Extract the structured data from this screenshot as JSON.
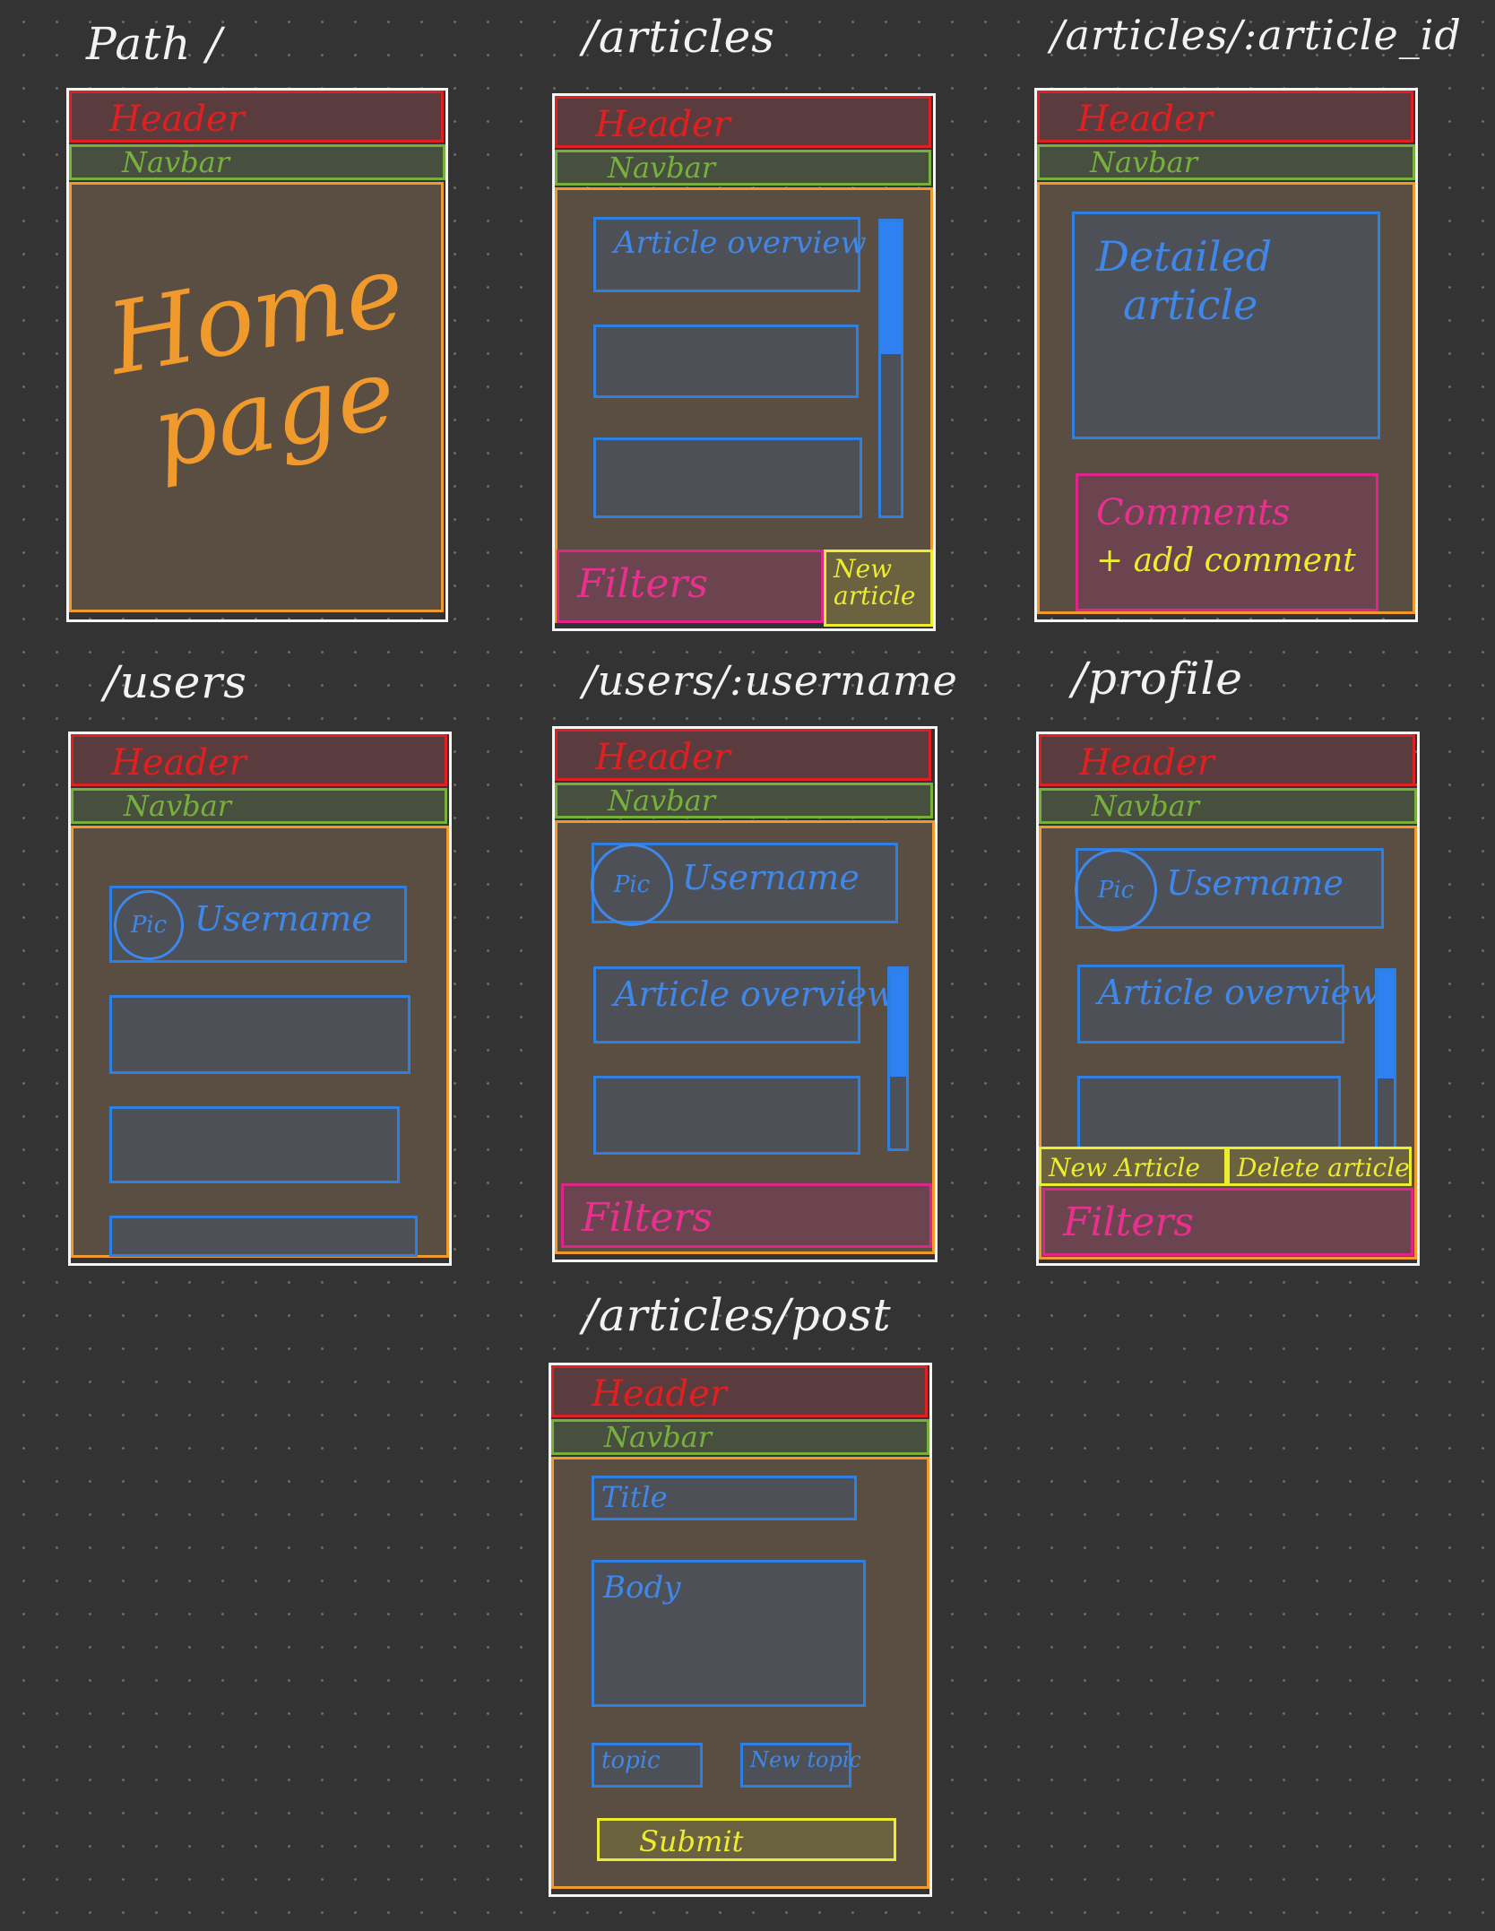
{
  "labels": {
    "root": "Path /",
    "articles": "/articles",
    "article_detail": "/articles/:article_id",
    "users": "/users",
    "user_detail": "/users/:username",
    "profile": "/profile",
    "post": "/articles/post"
  },
  "common": {
    "header": "Header",
    "navbar": "Navbar"
  },
  "home": {
    "line1": "Home",
    "line2": "page"
  },
  "articles_page": {
    "overview": "Article overview",
    "filters": "Filters",
    "new_article_line1": "New",
    "new_article_line2": "article",
    "scroll_fraction": 0.45
  },
  "article_detail_page": {
    "detail_line1": "Detailed",
    "detail_line2": "article",
    "comments_line1": "Comments",
    "comments_line2": "+ add comment"
  },
  "users_page": {
    "pic": "Pic",
    "username": "Username"
  },
  "user_detail_page": {
    "pic": "Pic",
    "username": "Username",
    "overview": "Article overview",
    "filters": "Filters",
    "scroll_fraction": 0.6
  },
  "profile_page": {
    "pic": "Pic",
    "username": "Username",
    "overview": "Article overview",
    "new_article": "New Article",
    "delete_article": "Delete article",
    "filters": "Filters",
    "scroll_fraction": 0.6
  },
  "post_page": {
    "title": "Title",
    "body": "Body",
    "topic": "topic",
    "new_topic": "New topic",
    "submit": "Submit"
  },
  "colors": {
    "background": "#333333",
    "header": "#e02020",
    "navbar": "#77b13c",
    "content": "#f09a2e",
    "component": "#2f7fe0",
    "filters": "#e0258a",
    "action": "#ecec30"
  }
}
